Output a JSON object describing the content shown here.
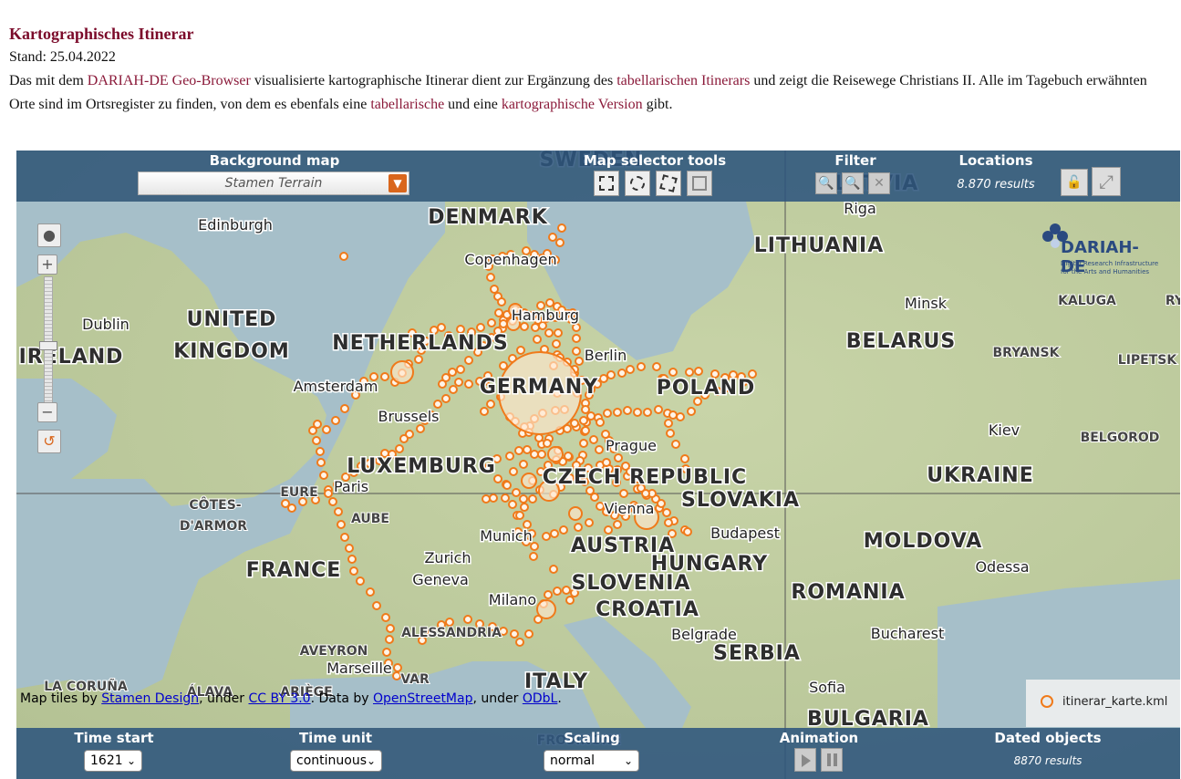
{
  "intro": {
    "heading": "Kartographisches Itinerar",
    "date": "Stand: 25.04.2022",
    "text_1": "Das mit dem ",
    "link_geo": "DARIAH-DE Geo-Browser",
    "text_2": " visualisierte kartographische Itinerar dient zur Ergänzung des ",
    "link_tab_itinerar": "tabellarischen Itinerars",
    "text_3": " und zeigt die Reisewege Christians II. Alle im Tagebuch erwähnten Orte sind im Ortsregister zu finden, von dem es ebenfals eine ",
    "link_tabellarische": "tabellarische",
    "text_4": " und eine ",
    "link_karto": "kartographische Version",
    "text_5": " gibt."
  },
  "topbar": {
    "background_label": "Background map",
    "background_value": "Stamen Terrain",
    "selector_label": "Map selector tools",
    "filter_label": "Filter",
    "locations_label": "Locations",
    "locations_count": "8.870 results"
  },
  "bottombar": {
    "time_start_label": "Time start",
    "time_start_value": "1621",
    "time_unit_label": "Time unit",
    "time_unit_value": "continuous",
    "scaling_label": "Scaling",
    "scaling_value": "normal",
    "animation_label": "Animation",
    "dated_label": "Dated objects",
    "dated_count": "8870 results"
  },
  "attribution": {
    "t1": "Map tiles by ",
    "l1": "Stamen Design",
    "t2": ", under ",
    "l2": "CC BY 3.0",
    "t3": ". Data by ",
    "l3": "OpenStreetMap",
    "t4": ", under ",
    "l4": "ODbL",
    "t5": "."
  },
  "legend": {
    "layer": "itinerar_karte.kml"
  },
  "logo": {
    "name": "DARIAH-DE",
    "line1": "Digital Research Infrastructure",
    "line2": "for the Arts and Humanities"
  },
  "map_labels": [
    {
      "text": "DENMARK",
      "kind": "country"
    },
    {
      "text": "LITHUANIA",
      "kind": "country"
    },
    {
      "text": "UNITED",
      "kind": "country"
    },
    {
      "text": "KINGDOM",
      "kind": "country"
    },
    {
      "text": "IRELAND",
      "kind": "country"
    },
    {
      "text": "NETHERLANDS",
      "kind": "country"
    },
    {
      "text": "BELARUS",
      "kind": "country"
    },
    {
      "text": "GERMANY",
      "kind": "country"
    },
    {
      "text": "POLAND",
      "kind": "country"
    },
    {
      "text": "LUXEMBURG",
      "kind": "country"
    },
    {
      "text": "CZECH REPUBLIC",
      "kind": "country"
    },
    {
      "text": "SLOVAKIA",
      "kind": "country"
    },
    {
      "text": "UKRAINE",
      "kind": "country"
    },
    {
      "text": "FRANCE",
      "kind": "country"
    },
    {
      "text": "AUSTRIA",
      "kind": "country"
    },
    {
      "text": "HUNGARY",
      "kind": "country"
    },
    {
      "text": "MOLDOVA",
      "kind": "country"
    },
    {
      "text": "SLOVENIA",
      "kind": "country"
    },
    {
      "text": "CROATIA",
      "kind": "country"
    },
    {
      "text": "ROMANIA",
      "kind": "country"
    },
    {
      "text": "SERBIA",
      "kind": "country"
    },
    {
      "text": "ITALY",
      "kind": "country"
    },
    {
      "text": "BULGARIA",
      "kind": "country"
    },
    {
      "text": "Edinburgh",
      "kind": "city"
    },
    {
      "text": "Dublin",
      "kind": "city"
    },
    {
      "text": "Copenhagen",
      "kind": "city"
    },
    {
      "text": "Hamburg",
      "kind": "city"
    },
    {
      "text": "Berlin",
      "kind": "city"
    },
    {
      "text": "Amsterdam",
      "kind": "city"
    },
    {
      "text": "Brussels",
      "kind": "city"
    },
    {
      "text": "Paris",
      "kind": "city"
    },
    {
      "text": "Prague",
      "kind": "city"
    },
    {
      "text": "Vienna",
      "kind": "city"
    },
    {
      "text": "Munich",
      "kind": "city"
    },
    {
      "text": "Zurich",
      "kind": "city"
    },
    {
      "text": "Geneva",
      "kind": "city"
    },
    {
      "text": "Milano",
      "kind": "city"
    },
    {
      "text": "Budapest",
      "kind": "city"
    },
    {
      "text": "Belgrade",
      "kind": "city"
    },
    {
      "text": "Bucharest",
      "kind": "city"
    },
    {
      "text": "Odessa",
      "kind": "city"
    },
    {
      "text": "Kiev",
      "kind": "city"
    },
    {
      "text": "Minsk",
      "kind": "city"
    },
    {
      "text": "Riga",
      "kind": "city"
    },
    {
      "text": "Marseille",
      "kind": "city"
    },
    {
      "text": "Sofia",
      "kind": "city"
    },
    {
      "text": "KALUGA",
      "kind": "region"
    },
    {
      "text": "BRYANSK",
      "kind": "region"
    },
    {
      "text": "LIPETSK",
      "kind": "region"
    },
    {
      "text": "BELGOROD",
      "kind": "region"
    },
    {
      "text": "CÔTES-",
      "kind": "region"
    },
    {
      "text": "D'ARMOR",
      "kind": "region"
    },
    {
      "text": "EURE",
      "kind": "region"
    },
    {
      "text": "AUBE",
      "kind": "region"
    },
    {
      "text": "AVEYRON",
      "kind": "region"
    },
    {
      "text": "ALESSANDRIA",
      "kind": "region"
    },
    {
      "text": "VAR",
      "kind": "region"
    },
    {
      "text": "ARIÈGE",
      "kind": "region"
    },
    {
      "text": "LA CORUÑA",
      "kind": "region"
    },
    {
      "text": "ÁLAVA",
      "kind": "region"
    },
    {
      "text": "SWEDEN",
      "kind": "country"
    },
    {
      "text": "LATVIA",
      "kind": "country"
    },
    {
      "text": "FROSINONE",
      "kind": "region"
    },
    {
      "text": "RY",
      "kind": "region"
    }
  ],
  "colors": {
    "bar": "#2d557d",
    "marker": "#f07a1a",
    "link": "#8b1a3a",
    "heading": "#7b0a2a"
  }
}
